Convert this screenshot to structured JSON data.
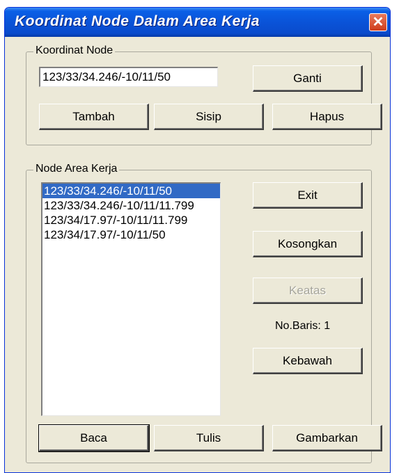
{
  "window": {
    "title": "Koordinat Node Dalam Area Kerja",
    "close_glyph": "✕"
  },
  "koordinat_group": {
    "legend": "Koordinat Node",
    "input_value": "123/33/34.246/-10/11/50",
    "ganti_label": "Ganti",
    "tambah_label": "Tambah",
    "sisip_label": "Sisip",
    "hapus_label": "Hapus"
  },
  "area_group": {
    "legend": "Node Area Kerja",
    "items": [
      "123/33/34.246/-10/11/50",
      "123/33/34.246/-10/11/11.799",
      "123/34/17.97/-10/11/11.799",
      "123/34/17.97/-10/11/50"
    ],
    "selected_index": 0,
    "exit_label": "Exit",
    "kosongkan_label": "Kosongkan",
    "keatas_label": "Keatas",
    "keatas_enabled": false,
    "nobaris_text": "No.Baris: 1",
    "kebawah_label": "Kebawah",
    "baca_label": "Baca",
    "tulis_label": "Tulis",
    "gambarkan_label": "Gambarkan"
  },
  "colors": {
    "titlebar": "#0a53d8",
    "selection": "#316ac5",
    "face": "#ece9d8",
    "close": "#d2482a"
  }
}
